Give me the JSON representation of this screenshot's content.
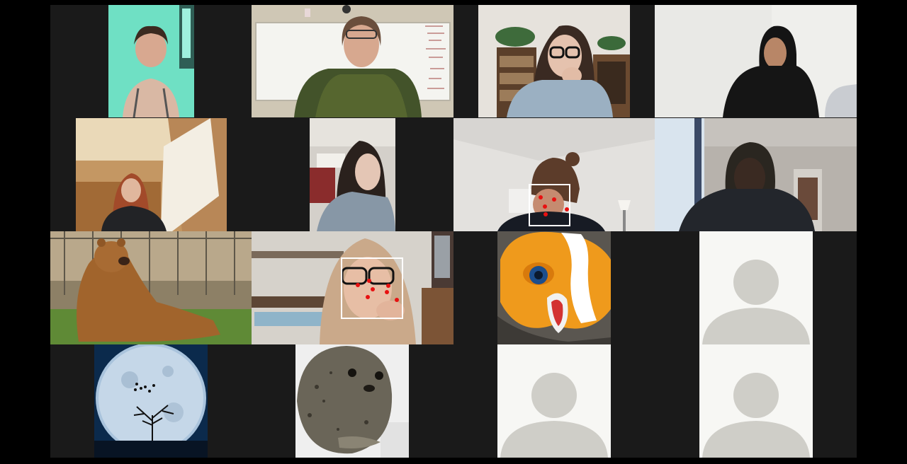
{
  "meeting": {
    "view": "gallery",
    "participants_visible": 16,
    "background": "#1a1a1a"
  },
  "participants": [
    {
      "id": "p1",
      "kind": "video",
      "scene": "teal-wall-room"
    },
    {
      "id": "p2",
      "kind": "video",
      "scene": "classroom-whiteboard"
    },
    {
      "id": "p3",
      "kind": "video",
      "scene": "bookshelf-room"
    },
    {
      "id": "p4",
      "kind": "video",
      "scene": "white-wall"
    },
    {
      "id": "p5",
      "kind": "video",
      "scene": "attic-room"
    },
    {
      "id": "p6",
      "kind": "video",
      "scene": "kitchen"
    },
    {
      "id": "p7",
      "kind": "video",
      "scene": "living-room",
      "face_tracking": true
    },
    {
      "id": "p8",
      "kind": "video",
      "scene": "window-room"
    },
    {
      "id": "p9",
      "kind": "image",
      "scene": "bear"
    },
    {
      "id": "p10",
      "kind": "video",
      "scene": "bedroom",
      "face_tracking": true
    },
    {
      "id": "p11",
      "kind": "image",
      "scene": "clownfish-plush"
    },
    {
      "id": "p12",
      "kind": "avatar",
      "icon": "person-silhouette-icon"
    },
    {
      "id": "p13",
      "kind": "image",
      "scene": "full-moon-tree"
    },
    {
      "id": "p14",
      "kind": "image",
      "scene": "seal"
    },
    {
      "id": "p15",
      "kind": "avatar",
      "icon": "person-silhouette-icon"
    },
    {
      "id": "p16",
      "kind": "avatar",
      "icon": "person-silhouette-icon"
    }
  ],
  "colors": {
    "face_box": "#ffffff",
    "landmark": "#e81010",
    "avatar_bg": "#f7f7f4",
    "avatar_figure": "#cfcec8"
  }
}
